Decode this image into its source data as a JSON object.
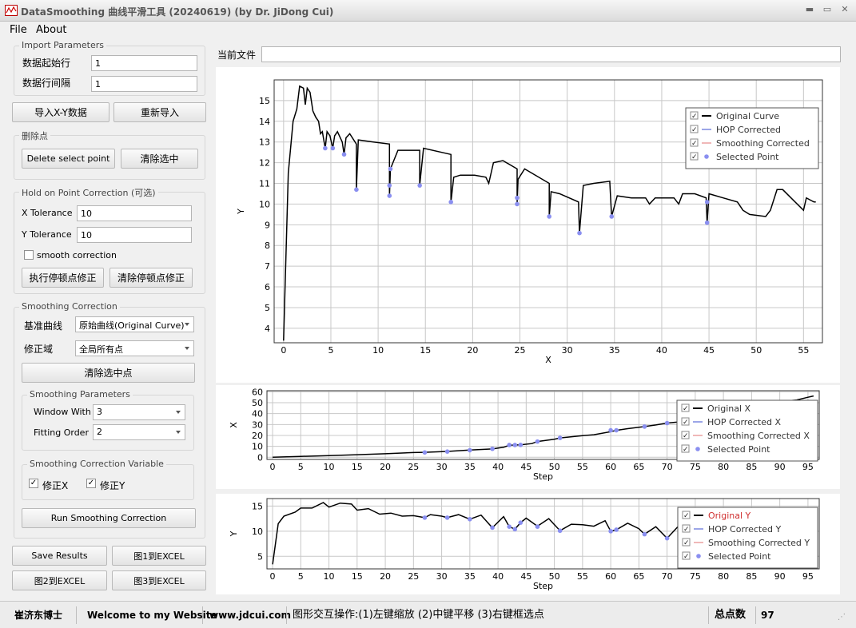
{
  "window": {
    "title": "DataSmoothing 曲线平滑工具 (20240619) (by Dr. JiDong Cui)"
  },
  "menu": [
    "File",
    "About"
  ],
  "import": {
    "title": "Import Parameters",
    "start_label": "数据起始行",
    "start_value": "1",
    "interval_label": "数据行间隔",
    "interval_value": "1"
  },
  "buttons": {
    "import_xy": "导入X-Y数据",
    "reimport": "重新导入"
  },
  "delete": {
    "title": "删除点",
    "delete_btn": "Delete select point",
    "clear_btn": "清除选中"
  },
  "hop": {
    "title": "Hold on Point Correction (可选)",
    "xtol_label": "X Tolerance",
    "xtol_value": "10",
    "ytol_label": "Y Tolerance",
    "ytol_value": "10",
    "smooth_label": "smooth correction",
    "exec_btn": "执行停顿点修正",
    "clear_btn": "清除停顿点修正"
  },
  "smoothing": {
    "title": "Smoothing Correction",
    "base_label": "基准曲线",
    "base_value": "原始曲线(Original Curve)",
    "domain_label": "修正域",
    "domain_value": "全局所有点",
    "clear_sel_btn": "清除选中点",
    "params_title": "Smoothing Parameters",
    "window_label": "Window With",
    "window_value": "3",
    "order_label": "Fitting Order",
    "order_value": "2",
    "var_title": "Smoothing Correction Variable",
    "fixx": "修正X",
    "fixy": "修正Y",
    "run_btn": "Run Smoothing Correction"
  },
  "bottom_buttons": {
    "save": "Save Results",
    "fig1": "图1到EXCEL",
    "fig2": "图2到EXCEL",
    "fig3": "图3到EXCEL"
  },
  "file": {
    "label": "当前文件",
    "value": ""
  },
  "status": {
    "author": "崔济东博士",
    "welcome": "Welcome to my Website",
    "site": "www.jdcui.com",
    "hint": "图形交互操作:(1)左键缩放 (2)中键平移 (3)右键框选点",
    "count_label": "总点数",
    "count_value": "97"
  },
  "colors": {
    "original": "#000000",
    "hop": "#3a4ed0",
    "smooth": "#e07070",
    "selected": "#8a8ff0"
  },
  "chart_data": [
    {
      "type": "line",
      "xlabel": "X",
      "ylabel": "Y",
      "xlim": [
        -1,
        57
      ],
      "ylim": [
        3.3,
        16
      ],
      "xticks": [
        0,
        5,
        10,
        15,
        20,
        25,
        30,
        35,
        40,
        45,
        50,
        55
      ],
      "yticks": [
        4,
        5,
        6,
        7,
        8,
        9,
        10,
        11,
        12,
        13,
        14,
        15
      ],
      "legend": {
        "placement": "top-right",
        "entries": [
          "Original Curve",
          "HOP Corrected",
          "Smoothing Corrected",
          "Selected Point"
        ]
      },
      "series": [
        {
          "name": "Original Curve",
          "points": [
            [
              0.0,
              3.4
            ],
            [
              0.5,
              11.5
            ],
            [
              1.0,
              14.0
            ],
            [
              1.4,
              14.6
            ],
            [
              1.7,
              15.7
            ],
            [
              2.1,
              15.6
            ],
            [
              2.3,
              14.8
            ],
            [
              2.5,
              15.6
            ],
            [
              2.8,
              15.4
            ],
            [
              3.1,
              14.5
            ],
            [
              3.4,
              14.2
            ],
            [
              3.7,
              14.0
            ],
            [
              3.9,
              13.4
            ],
            [
              4.1,
              13.5
            ],
            [
              4.4,
              12.7
            ],
            [
              4.6,
              13.5
            ],
            [
              4.9,
              13.3
            ],
            [
              5.2,
              12.7
            ],
            [
              5.4,
              13.3
            ],
            [
              5.7,
              13.5
            ],
            [
              6.2,
              13.0
            ],
            [
              6.4,
              12.4
            ],
            [
              6.6,
              13.2
            ],
            [
              7.0,
              13.4
            ],
            [
              7.7,
              12.9
            ],
            [
              7.7,
              10.7
            ],
            [
              7.9,
              13.1
            ],
            [
              9.5,
              13.0
            ],
            [
              11.2,
              12.9
            ],
            [
              11.2,
              10.4
            ],
            [
              11.3,
              11.7
            ],
            [
              12.1,
              12.6
            ],
            [
              14.4,
              12.6
            ],
            [
              14.4,
              10.9
            ],
            [
              14.8,
              12.7
            ],
            [
              17.7,
              12.4
            ],
            [
              17.7,
              10.1
            ],
            [
              18.0,
              11.3
            ],
            [
              18.7,
              11.4
            ],
            [
              20.2,
              11.4
            ],
            [
              21.4,
              11.3
            ],
            [
              21.7,
              11.0
            ],
            [
              22.2,
              12.0
            ],
            [
              23.2,
              12.1
            ],
            [
              24.7,
              11.7
            ],
            [
              24.7,
              10.0
            ],
            [
              24.8,
              11.2
            ],
            [
              25.5,
              11.7
            ],
            [
              28.1,
              11.0
            ],
            [
              28.1,
              9.4
            ],
            [
              28.3,
              10.6
            ],
            [
              29.2,
              10.5
            ],
            [
              31.2,
              10.1
            ],
            [
              31.3,
              8.6
            ],
            [
              31.7,
              10.9
            ],
            [
              32.8,
              11.0
            ],
            [
              34.5,
              11.1
            ],
            [
              34.7,
              9.4
            ],
            [
              35.3,
              10.4
            ],
            [
              36.8,
              10.3
            ],
            [
              38.3,
              10.3
            ],
            [
              38.7,
              10.0
            ],
            [
              39.3,
              10.3
            ],
            [
              41.3,
              10.3
            ],
            [
              41.8,
              10.0
            ],
            [
              42.2,
              10.5
            ],
            [
              43.5,
              10.5
            ],
            [
              44.7,
              10.3
            ],
            [
              44.8,
              9.1
            ],
            [
              45.0,
              10.5
            ],
            [
              46.5,
              10.3
            ],
            [
              48.0,
              10.1
            ],
            [
              48.6,
              9.7
            ],
            [
              49.3,
              9.5
            ],
            [
              51.0,
              9.4
            ],
            [
              51.5,
              9.7
            ],
            [
              52.2,
              10.7
            ],
            [
              52.8,
              10.7
            ],
            [
              55.0,
              9.7
            ],
            [
              55.3,
              10.3
            ],
            [
              56.1,
              10.1
            ],
            [
              56.3,
              10.1
            ]
          ]
        }
      ],
      "selected_points": [
        [
          4.4,
          12.7
        ],
        [
          5.2,
          12.7
        ],
        [
          6.4,
          12.4
        ],
        [
          7.7,
          10.7
        ],
        [
          11.2,
          10.9
        ],
        [
          11.2,
          10.4
        ],
        [
          11.3,
          11.7
        ],
        [
          14.4,
          10.9
        ],
        [
          17.7,
          10.1
        ],
        [
          24.7,
          10.0
        ],
        [
          24.7,
          10.3
        ],
        [
          28.1,
          9.4
        ],
        [
          31.3,
          8.6
        ],
        [
          34.7,
          9.4
        ],
        [
          44.8,
          9.1
        ],
        [
          44.8,
          10.1
        ]
      ]
    },
    {
      "type": "line",
      "xlabel": "Step",
      "ylabel": "X",
      "xlim": [
        -1,
        97
      ],
      "ylim": [
        -2,
        61
      ],
      "xticks": [
        0,
        5,
        10,
        15,
        20,
        25,
        30,
        35,
        40,
        45,
        50,
        55,
        60,
        65,
        70,
        75,
        80,
        85,
        90,
        95
      ],
      "yticks": [
        0,
        10,
        20,
        30,
        40,
        50,
        60
      ],
      "legend": {
        "placement": "top-right",
        "entries": [
          "Original X",
          "HOP Corrected X",
          "Smoothing Corrected X",
          "Selected Point"
        ]
      },
      "series": [
        {
          "name": "Original X",
          "points": [
            [
              0,
              0
            ],
            [
              5,
              0.8
            ],
            [
              10,
              1.5
            ],
            [
              15,
              2.3
            ],
            [
              20,
              3.2
            ],
            [
              25,
              4.3
            ],
            [
              27,
              4.5
            ],
            [
              31,
              5.3
            ],
            [
              35,
              6.6
            ],
            [
              39,
              7.6
            ],
            [
              41,
              9.1
            ],
            [
              42,
              11.0
            ],
            [
              43,
              11.2
            ],
            [
              44,
              11.4
            ],
            [
              46,
              12.5
            ],
            [
              47,
              14.4
            ],
            [
              50,
              16.5
            ],
            [
              51,
              17.7
            ],
            [
              55,
              19.8
            ],
            [
              57,
              20.6
            ],
            [
              60,
              23.4
            ],
            [
              61,
              24.7
            ],
            [
              63,
              26.2
            ],
            [
              66,
              28.1
            ],
            [
              68,
              29.6
            ],
            [
              70,
              31.3
            ],
            [
              73,
              32.8
            ],
            [
              75,
              34.7
            ],
            [
              78,
              38.0
            ],
            [
              80,
              40.8
            ],
            [
              83,
              44.8
            ],
            [
              86,
              46.5
            ],
            [
              88,
              49.0
            ],
            [
              90,
              51.0
            ],
            [
              93,
              52.5
            ],
            [
              95,
              55.0
            ],
            [
              96,
              56.2
            ]
          ]
        }
      ],
      "selected_points": [
        [
          27,
          4.4
        ],
        [
          31,
          5.2
        ],
        [
          35,
          6.4
        ],
        [
          39,
          7.7
        ],
        [
          42,
          11.2
        ],
        [
          43,
          11.2
        ],
        [
          44,
          11.3
        ],
        [
          47,
          14.4
        ],
        [
          51,
          17.7
        ],
        [
          60,
          24.7
        ],
        [
          61,
          24.7
        ],
        [
          66,
          28.1
        ],
        [
          70,
          31.3
        ]
      ]
    },
    {
      "type": "line",
      "xlabel": "Step",
      "ylabel": "Y",
      "xlim": [
        -1,
        97
      ],
      "ylim": [
        2.5,
        16.5
      ],
      "xticks": [
        0,
        5,
        10,
        15,
        20,
        25,
        30,
        35,
        40,
        45,
        50,
        55,
        60,
        65,
        70,
        75,
        80,
        85,
        90,
        95
      ],
      "yticks": [
        5,
        10,
        15
      ],
      "legend": {
        "placement": "top-right",
        "entries": [
          "Original Y",
          "HOP Corrected Y",
          "Smoothing Corrected Y",
          "Selected Point"
        ]
      },
      "series": [
        {
          "name": "Original Y",
          "points": [
            [
              0,
              3.4
            ],
            [
              1,
              11.5
            ],
            [
              2,
              13.0
            ],
            [
              4,
              13.8
            ],
            [
              5,
              14.6
            ],
            [
              7,
              14.6
            ],
            [
              9,
              15.7
            ],
            [
              10,
              14.8
            ],
            [
              12,
              15.6
            ],
            [
              14,
              15.4
            ],
            [
              15,
              14.2
            ],
            [
              17,
              14.5
            ],
            [
              19,
              13.4
            ],
            [
              21,
              13.6
            ],
            [
              23,
              13.0
            ],
            [
              25,
              13.1
            ],
            [
              27,
              12.7
            ],
            [
              28,
              13.3
            ],
            [
              30,
              13.0
            ],
            [
              31,
              12.7
            ],
            [
              33,
              13.3
            ],
            [
              35,
              12.4
            ],
            [
              37,
              13.2
            ],
            [
              39,
              10.7
            ],
            [
              41,
              12.9
            ],
            [
              42,
              10.9
            ],
            [
              43,
              10.4
            ],
            [
              44,
              11.7
            ],
            [
              45,
              12.6
            ],
            [
              47,
              11.0
            ],
            [
              49,
              12.5
            ],
            [
              51,
              10.1
            ],
            [
              53,
              11.4
            ],
            [
              55,
              11.3
            ],
            [
              57,
              11.0
            ],
            [
              59,
              12.1
            ],
            [
              60,
              10.0
            ],
            [
              61,
              10.3
            ],
            [
              63,
              11.6
            ],
            [
              65,
              10.5
            ],
            [
              66,
              9.4
            ],
            [
              68,
              10.9
            ],
            [
              70,
              8.6
            ],
            [
              72,
              11.0
            ],
            [
              74,
              10.5
            ],
            [
              76,
              10.1
            ],
            [
              78,
              10.3
            ],
            [
              80,
              10.0
            ],
            [
              82,
              10.5
            ],
            [
              84,
              9.7
            ],
            [
              86,
              10.1
            ],
            [
              88,
              9.5
            ],
            [
              90,
              10.7
            ],
            [
              92,
              9.7
            ],
            [
              94,
              10.2
            ],
            [
              96,
              10.1
            ]
          ]
        }
      ],
      "selected_points": [
        [
          27,
          12.7
        ],
        [
          31,
          12.7
        ],
        [
          35,
          12.4
        ],
        [
          39,
          10.7
        ],
        [
          42,
          10.9
        ],
        [
          43,
          10.4
        ],
        [
          44,
          11.7
        ],
        [
          47,
          10.9
        ],
        [
          51,
          10.1
        ],
        [
          60,
          10.0
        ],
        [
          61,
          10.3
        ],
        [
          66,
          9.4
        ],
        [
          70,
          8.6
        ]
      ]
    }
  ]
}
